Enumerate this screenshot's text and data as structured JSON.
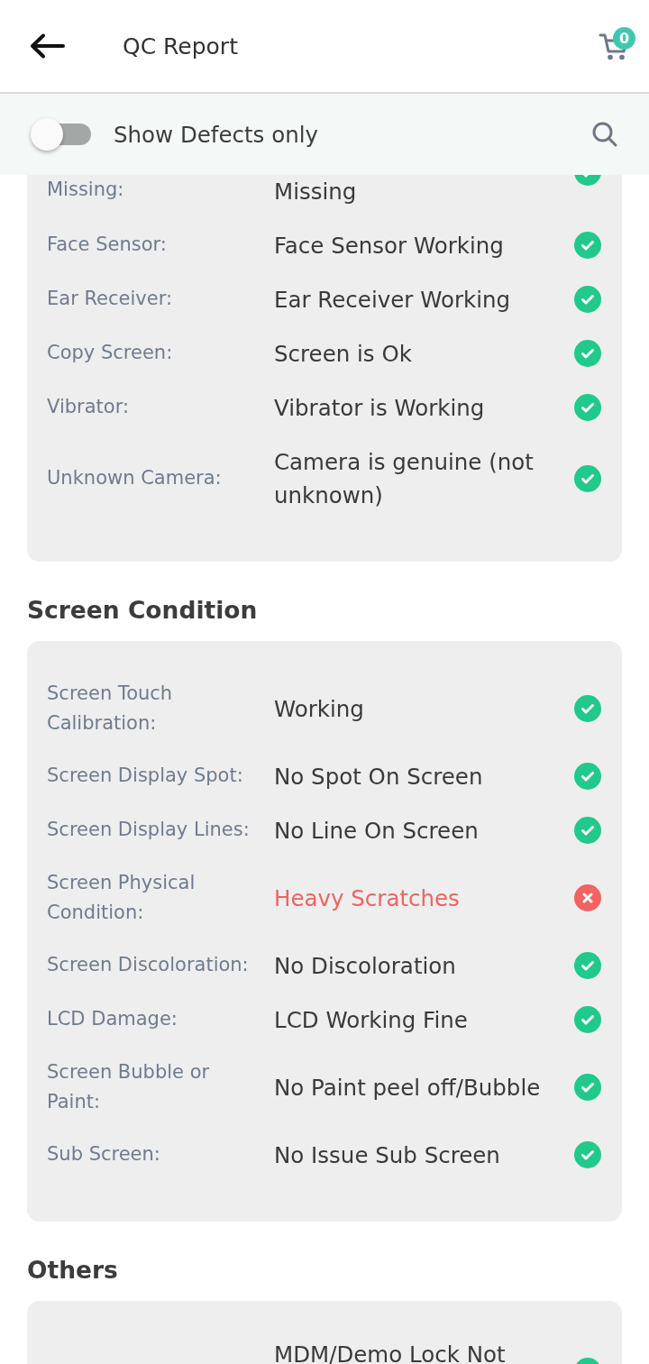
{
  "header": {
    "title": "QC Report",
    "cart_count": "0"
  },
  "filter": {
    "label": "Show Defects only",
    "on": false
  },
  "sections": [
    {
      "continued_from_above": true,
      "rows": [
        {
          "label": "Missing:",
          "value": "Missing",
          "passed": true
        },
        {
          "label": "Face Sensor:",
          "value": "Face Sensor Working",
          "passed": true
        },
        {
          "label": "Ear Receiver:",
          "value": "Ear Receiver Working",
          "passed": true
        },
        {
          "label": "Copy Screen:",
          "value": "Screen is Ok",
          "passed": true
        },
        {
          "label": "Vibrator:",
          "value": "Vibrator is Working",
          "passed": true
        },
        {
          "label": "Unknown Camera:",
          "value": "Camera is genuine (not unknown)",
          "passed": true
        }
      ]
    },
    {
      "title": "Screen Condition",
      "rows": [
        {
          "label": "Screen Touch Calibration:",
          "value": "Working",
          "passed": true
        },
        {
          "label": "Screen Display Spot:",
          "value": "No Spot On Screen",
          "passed": true
        },
        {
          "label": "Screen Display Lines:",
          "value": "No Line On Screen",
          "passed": true
        },
        {
          "label": "Screen Physical Condition:",
          "value": "Heavy Scratches",
          "passed": false
        },
        {
          "label": "Screen Discoloration:",
          "value": "No Discoloration",
          "passed": true
        },
        {
          "label": "LCD Damage:",
          "value": "LCD Working Fine",
          "passed": true
        },
        {
          "label": "Screen Bubble or Paint:",
          "value": "No Paint peel off/Bubble",
          "passed": true
        },
        {
          "label": "Sub Screen:",
          "value": "No Issue Sub Screen",
          "passed": true
        }
      ]
    },
    {
      "title": "Others",
      "continues_below": true,
      "rows": [
        {
          "value": "MDM/Demo Lock Not",
          "passed": true
        }
      ]
    }
  ]
}
